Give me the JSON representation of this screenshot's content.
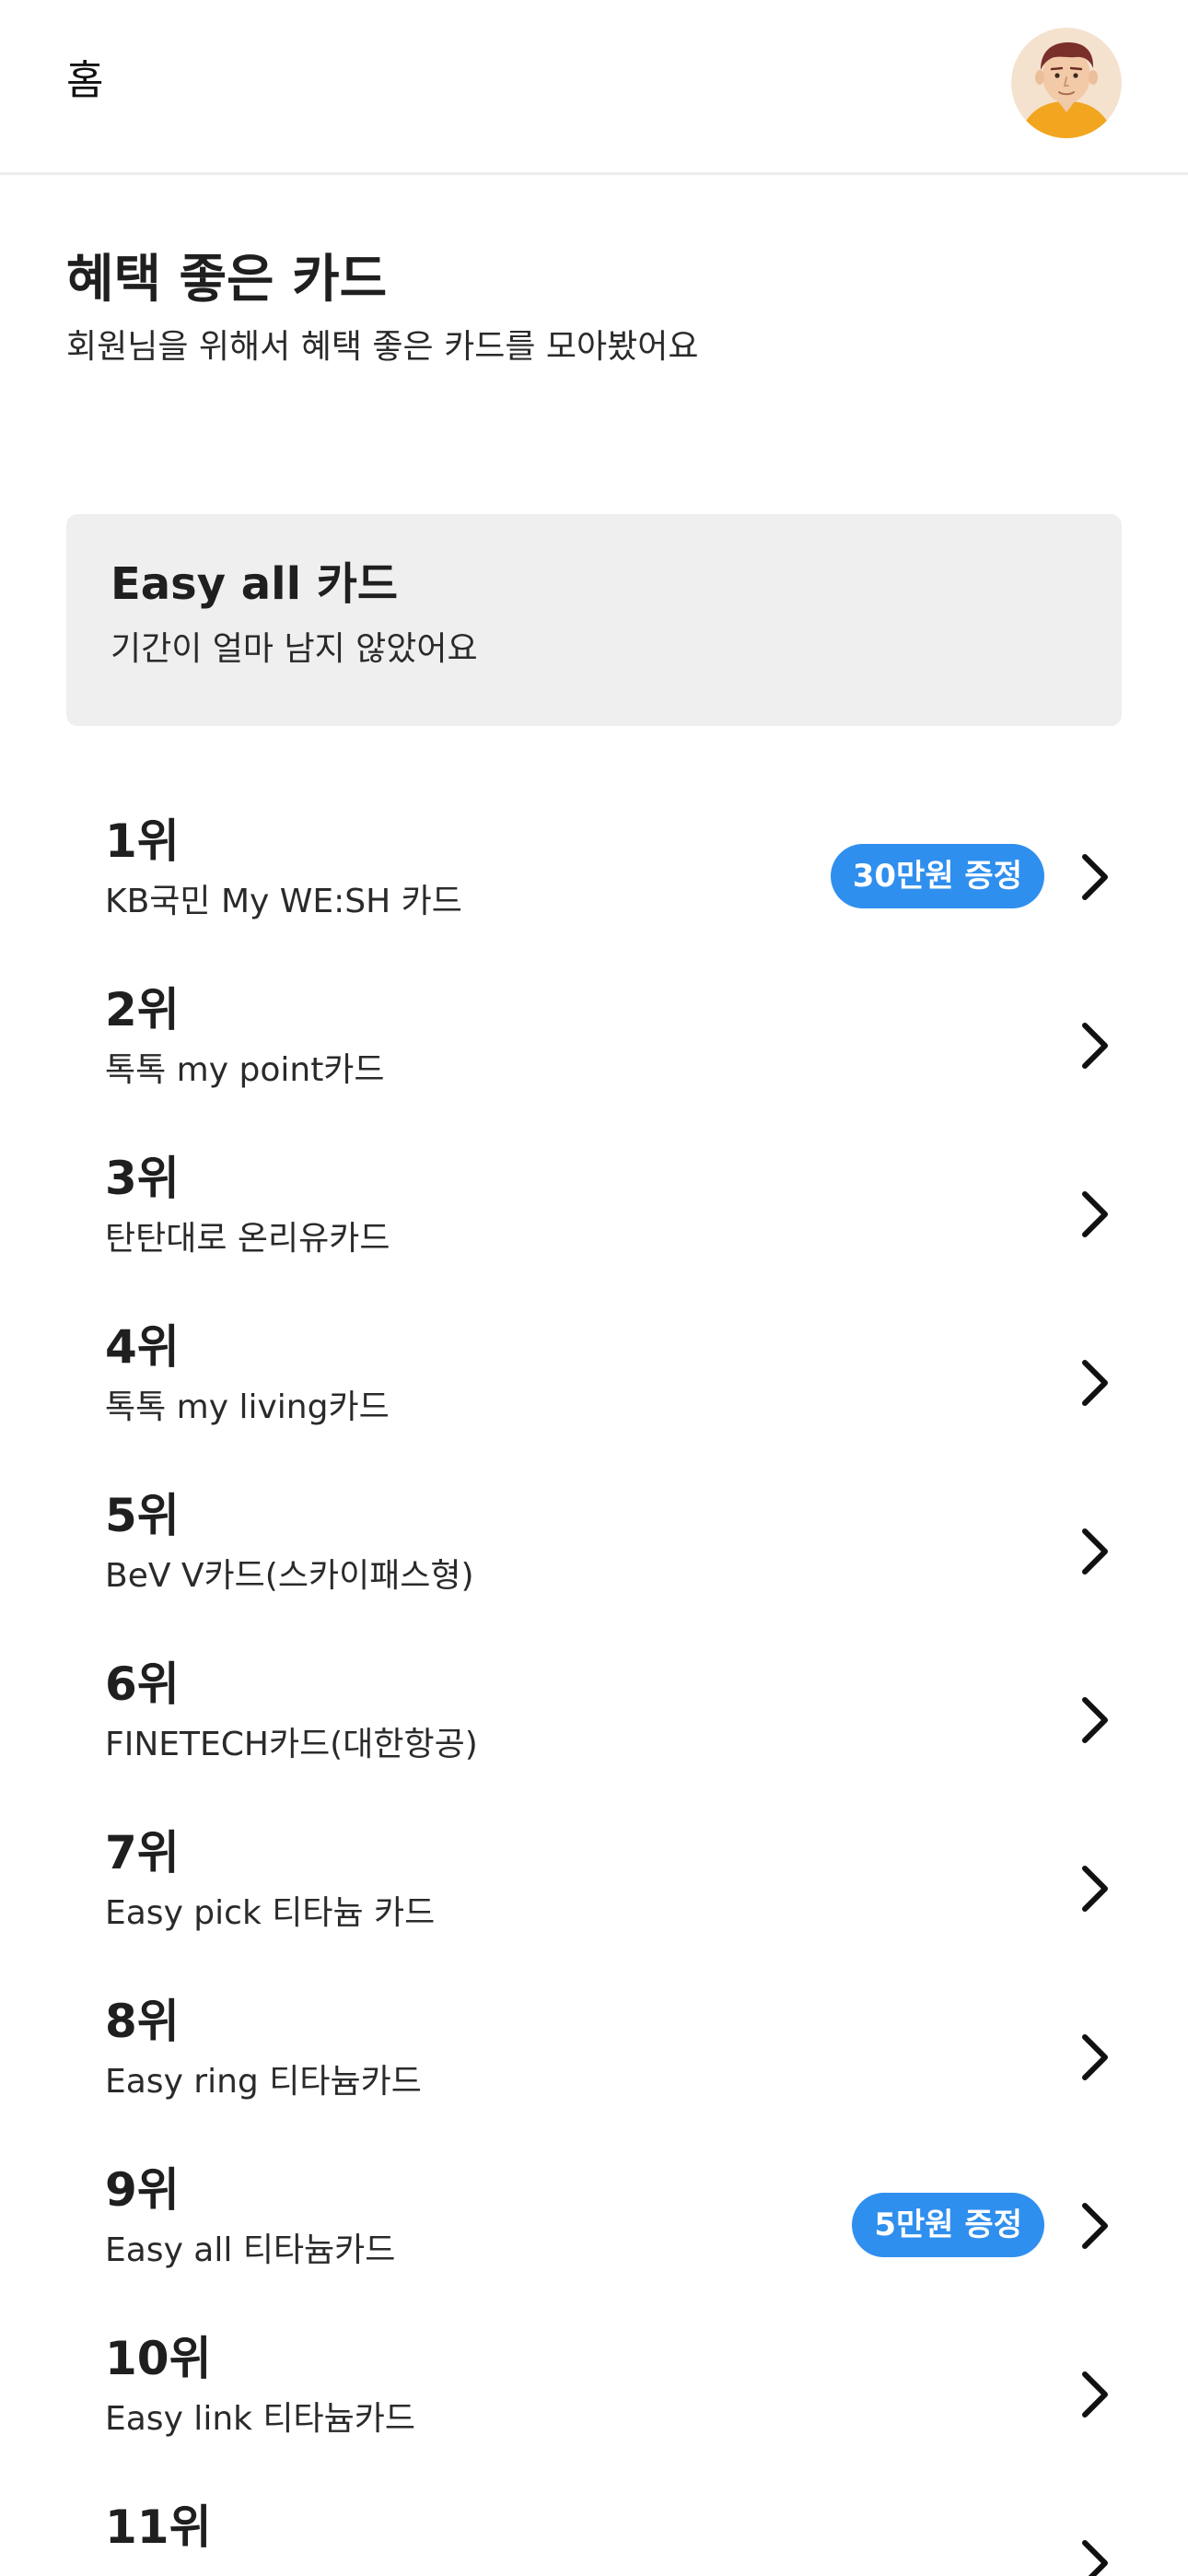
{
  "header": {
    "title": "홈",
    "avatar_icon": "user-avatar-icon"
  },
  "intro": {
    "title": "혜택 좋은 카드",
    "subtitle": "회원님을 위해서 혜택 좋은 카드를 모아봤어요"
  },
  "promo": {
    "title": "Easy all 카드",
    "subtitle": "기간이 얼마 남지 않았어요"
  },
  "ranking": [
    {
      "rank": "1위",
      "name": "KB국민 My WE:SH 카드",
      "badge": "30만원 증정"
    },
    {
      "rank": "2위",
      "name": "톡톡 my point카드"
    },
    {
      "rank": "3위",
      "name": "탄탄대로 온리유카드"
    },
    {
      "rank": "4위",
      "name": "톡톡 my living카드"
    },
    {
      "rank": "5위",
      "name": "BeV V카드(스카이패스형)"
    },
    {
      "rank": "6위",
      "name": "FINETECH카드(대한항공)"
    },
    {
      "rank": "7위",
      "name": "Easy pick 티타늄 카드"
    },
    {
      "rank": "8위",
      "name": "Easy ring 티타늄카드"
    },
    {
      "rank": "9위",
      "name": "Easy all 티타늄카드",
      "badge": "5만원 증정"
    },
    {
      "rank": "10위",
      "name": "Easy link 티타늄카드"
    },
    {
      "rank": "11위",
      "name": ""
    }
  ],
  "colors": {
    "badge": "#2f8fee",
    "promo_bg": "#efefef",
    "divider": "#ececec"
  }
}
